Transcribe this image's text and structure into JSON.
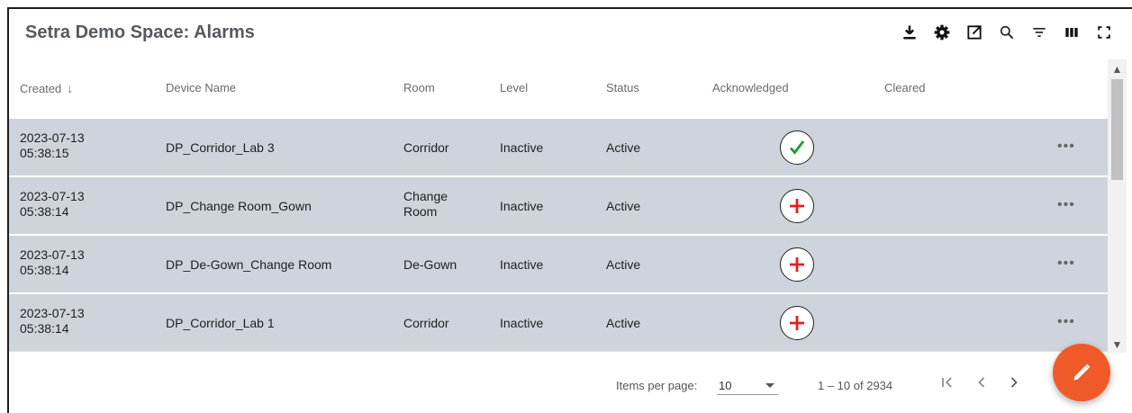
{
  "header": {
    "title": "Setra Demo Space: Alarms",
    "toolbar_icons": [
      "download-icon",
      "settings-icon",
      "open-external-icon",
      "search-icon",
      "filter-icon",
      "columns-icon",
      "fullscreen-icon"
    ]
  },
  "table": {
    "columns": {
      "created": "Created",
      "sort_arrow": "↓",
      "device": "Device Name",
      "room": "Room",
      "level": "Level",
      "status": "Status",
      "acknowledged": "Acknowledged",
      "cleared": "Cleared"
    },
    "rows": [
      {
        "date": "2023-07-13",
        "time": "05:38:15",
        "device": "DP_Corridor_Lab 3",
        "room_line1": "Corridor",
        "room_line2": "",
        "level": "Inactive",
        "status": "Active",
        "ack_icon": "check-icon",
        "more": "•••"
      },
      {
        "date": "2023-07-13",
        "time": "05:38:14",
        "device": "DP_Change Room_Gown",
        "room_line1": "Change",
        "room_line2": "Room",
        "level": "Inactive",
        "status": "Active",
        "ack_icon": "plus-icon",
        "more": "•••"
      },
      {
        "date": "2023-07-13",
        "time": "05:38:14",
        "device": "DP_De-Gown_Change Room",
        "room_line1": "De-Gown",
        "room_line2": "",
        "level": "Inactive",
        "status": "Active",
        "ack_icon": "plus-icon",
        "more": "•••"
      },
      {
        "date": "2023-07-13",
        "time": "05:38:14",
        "device": "DP_Corridor_Lab 1",
        "room_line1": "Corridor",
        "room_line2": "",
        "level": "Inactive",
        "status": "Active",
        "ack_icon": "plus-icon",
        "more": "•••"
      }
    ]
  },
  "pagination": {
    "items_per_page_label": "Items per page:",
    "items_per_page_value": "10",
    "range_label": "1 – 10 of 2934"
  },
  "colors": {
    "row_bg": "#cfd4dc",
    "check_green": "#1e9c2a",
    "plus_red": "#e02020",
    "fab_orange": "#f05a28"
  }
}
